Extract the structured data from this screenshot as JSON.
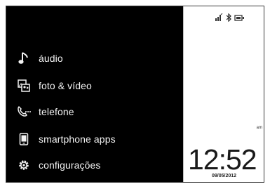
{
  "menu": {
    "items": [
      {
        "label": "áudio",
        "icon": "music-note-icon"
      },
      {
        "label": "foto & vídeo",
        "icon": "photo-video-icon"
      },
      {
        "label": "telefone",
        "icon": "phone-icon"
      },
      {
        "label": "smartphone apps",
        "icon": "smartphone-icon"
      },
      {
        "label": "configurações",
        "icon": "settings-gear-icon"
      }
    ]
  },
  "status": {
    "icons": [
      "signal-icon",
      "bluetooth-icon",
      "battery-icon"
    ]
  },
  "panel": {
    "unit_label": "am",
    "time": "12:52",
    "date": "09/05/2012"
  },
  "colors": {
    "menu_background": "#000000",
    "menu_text": "#f2f2f2",
    "panel_background": "#ffffff",
    "clock_text": "#1a1a1a"
  }
}
